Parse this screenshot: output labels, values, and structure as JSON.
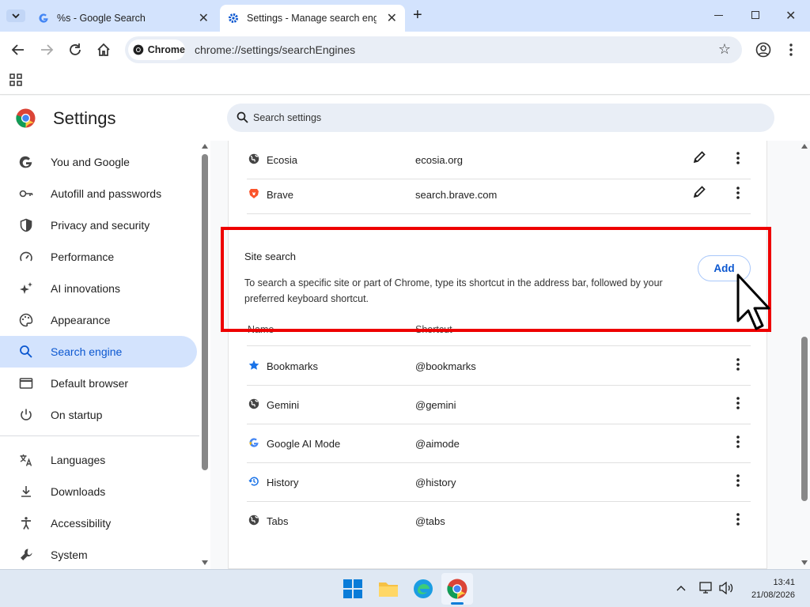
{
  "browser": {
    "tabs": [
      {
        "title": "%s - Google Search"
      },
      {
        "title": "Settings - Manage search engines"
      }
    ],
    "omnibox_chip": "Chrome",
    "url": "chrome://settings/searchEngines"
  },
  "settings": {
    "title": "Settings",
    "search_placeholder": "Search settings",
    "nav": [
      {
        "label": "You and Google",
        "icon": "google-g-icon"
      },
      {
        "label": "Autofill and passwords",
        "icon": "key-icon"
      },
      {
        "label": "Privacy and security",
        "icon": "shield-icon"
      },
      {
        "label": "Performance",
        "icon": "speedometer-icon"
      },
      {
        "label": "AI innovations",
        "icon": "sparkle-icon"
      },
      {
        "label": "Appearance",
        "icon": "palette-icon"
      },
      {
        "label": "Search engine",
        "icon": "search-icon",
        "selected": true
      },
      {
        "label": "Default browser",
        "icon": "browser-window-icon"
      },
      {
        "label": "On startup",
        "icon": "power-icon"
      },
      {
        "label": "Languages",
        "icon": "translate-icon"
      },
      {
        "label": "Downloads",
        "icon": "download-icon"
      },
      {
        "label": "Accessibility",
        "icon": "accessibility-icon"
      },
      {
        "label": "System",
        "icon": "wrench-icon"
      }
    ]
  },
  "engines": [
    {
      "name": "Ecosia",
      "shortcut": "ecosia.org",
      "icon": "globe-icon"
    },
    {
      "name": "Brave",
      "shortcut": "search.brave.com",
      "icon": "brave-lion-icon"
    }
  ],
  "site_search": {
    "heading": "Site search",
    "description": "To search a specific site or part of Chrome, type its shortcut in the address bar, followed by your preferred keyboard shortcut.",
    "add_label": "Add",
    "col_name": "Name",
    "col_shortcut": "Shortcut",
    "rows": [
      {
        "name": "Bookmarks",
        "shortcut": "@bookmarks",
        "icon": "star-icon"
      },
      {
        "name": "Gemini",
        "shortcut": "@gemini",
        "icon": "globe-icon"
      },
      {
        "name": "Google AI Mode",
        "shortcut": "@aimode",
        "icon": "google-g-icon"
      },
      {
        "name": "History",
        "shortcut": "@history",
        "icon": "history-icon"
      },
      {
        "name": "Tabs",
        "shortcut": "@tabs",
        "icon": "globe-icon"
      }
    ]
  },
  "taskbar": {
    "time": "13:41",
    "date": "21/08/2026"
  },
  "colors": {
    "accent": "#0b57d0",
    "selected_bg": "#d3e3fd",
    "highlight_box": "#ee0000"
  }
}
